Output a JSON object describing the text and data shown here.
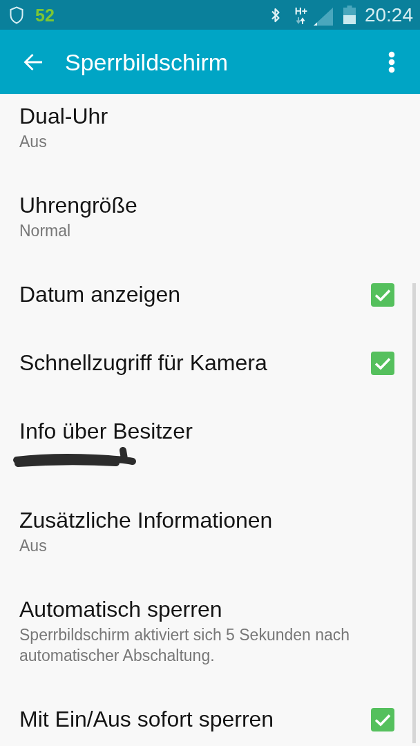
{
  "status_bar": {
    "notification_count": "52",
    "network_type": "H+",
    "time": "20:24"
  },
  "app_bar": {
    "title": "Sperrbildschirm"
  },
  "settings": [
    {
      "kind": "summary",
      "title": "Dual-Uhr",
      "summary": "Aus"
    },
    {
      "kind": "summary",
      "title": "Uhrengröße",
      "summary": "Normal"
    },
    {
      "kind": "checkbox",
      "title": "Datum anzeigen",
      "checked": true
    },
    {
      "kind": "checkbox",
      "title": "Schnellzugriff für Kamera",
      "checked": true
    },
    {
      "kind": "redacted",
      "title": "Info über Besitzer"
    },
    {
      "kind": "summary",
      "title": "Zusätzliche Informationen",
      "summary": "Aus"
    },
    {
      "kind": "summary",
      "title": "Automatisch sperren",
      "summary": "Sperrbildschirm aktiviert sich 5 Sekunden nach automatischer Abschaltung."
    },
    {
      "kind": "checkbox",
      "title": "Mit Ein/Aus sofort sperren",
      "checked": true
    }
  ]
}
